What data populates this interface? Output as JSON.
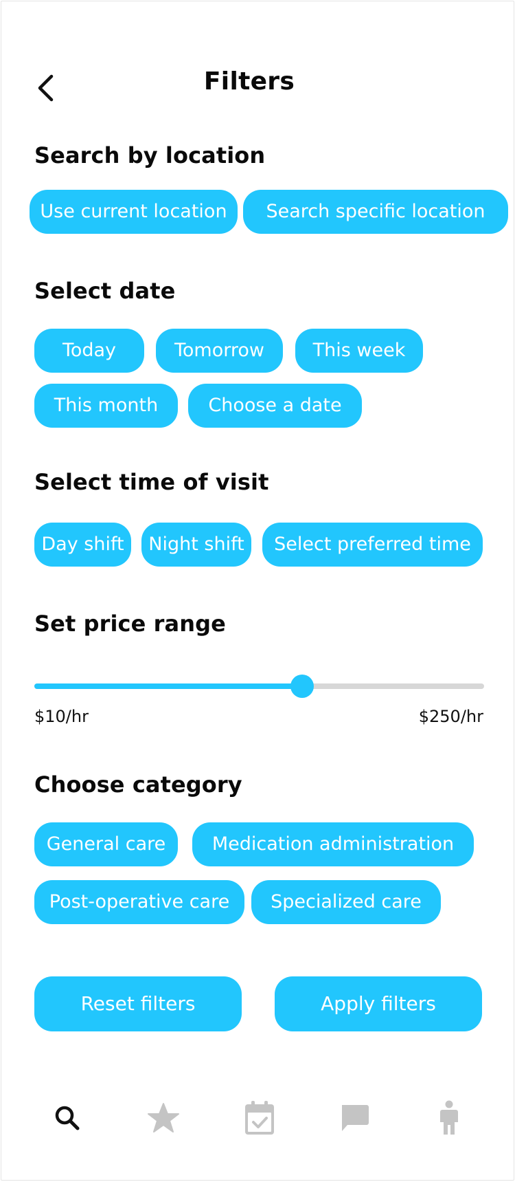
{
  "header": {
    "title": "Filters"
  },
  "location": {
    "heading": "Search by location",
    "chips": [
      "Use current location",
      "Search specific location"
    ]
  },
  "date": {
    "heading": "Select date",
    "chips": [
      "Today",
      "Tomorrow",
      "This week",
      "This month",
      "Choose a date"
    ]
  },
  "time": {
    "heading": "Select time of visit",
    "chips": [
      "Day shift",
      "Night shift",
      "Select preferred time"
    ]
  },
  "price": {
    "heading": "Set price range",
    "min_label": "$10/hr",
    "max_label": "$250/hr",
    "slider_fraction": 0.595
  },
  "category": {
    "heading": "Choose category",
    "chips": [
      "General care",
      "Medication administration",
      "Post-operative care",
      "Specialized care"
    ]
  },
  "actions": {
    "reset": "Reset filters",
    "apply": "Apply filters"
  },
  "tabbar": {
    "icons": [
      "search-icon",
      "star-icon",
      "calendar-check-icon",
      "chat-icon",
      "person-icon"
    ],
    "active": "search-icon"
  },
  "colors": {
    "accent": "#22c6fd",
    "track": "#d7d7d7",
    "tab_active": "#111111",
    "tab_inactive": "#c4c4c4"
  }
}
